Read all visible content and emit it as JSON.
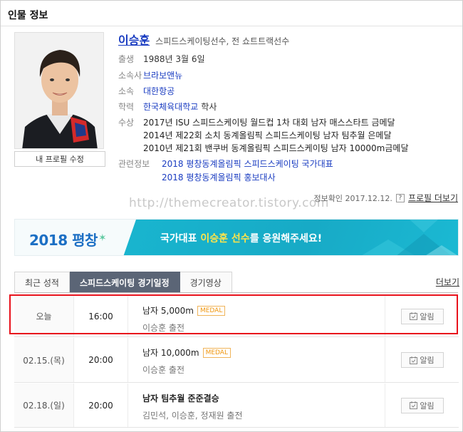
{
  "section_title": "인물 정보",
  "profile": {
    "edit_label": "내 프로필 수정",
    "name": "이승훈",
    "job": "스피드스케이팅선수, 전 쇼트트랙선수",
    "birth_label": "출생",
    "birth": "1988년 3월 6일",
    "agency_label": "소속사",
    "agency": "브라보앤뉴",
    "team_label": "소속",
    "team": "대한항공",
    "edu_label": "학력",
    "edu_school": "한국체육대학교",
    "edu_degree": "학사",
    "awards_label": "수상",
    "awards": [
      "2017년 ISU 스피드스케이팅 월드컵 1차 대회 남자 매스스타트 금메달",
      "2014년 제22회 소치 동계올림픽 스피드스케이팅 남자 팀추월 은메달",
      "2010년 제21회 밴쿠버 동계올림픽 스피드스케이팅 남자 10000m금메달"
    ],
    "related_label": "관련정보",
    "related": [
      "2018 평창동계올림픽 스피드스케이팅 국가대표",
      "2018 평창동계올림픽 홍보대사"
    ]
  },
  "watermark": "http://themecreator.tistory.com",
  "confirm": {
    "text": "정보확인 2017.12.12.",
    "help": "?",
    "more": "프로필 더보기"
  },
  "banner": {
    "left_text": "2018 평창",
    "pre": "국가대표 ",
    "highlight": "이승훈 선수",
    "post": "를 응원해주세요!"
  },
  "tabs": [
    {
      "label": "최근 성적",
      "active": false
    },
    {
      "label": "스피드스케이팅 경기일정",
      "active": true
    },
    {
      "label": "경기영상",
      "active": false
    }
  ],
  "tabs_more": "더보기",
  "schedule": [
    {
      "date": "오늘",
      "time": "16:00",
      "event": "남자 5,000m",
      "medal": "MEDAL",
      "players": "이승훈 출전",
      "alarm": "알림"
    },
    {
      "date": "02.15.(목)",
      "time": "20:00",
      "event": "남자 10,000m",
      "medal": "MEDAL",
      "players": "이승훈 출전",
      "alarm": "알림"
    },
    {
      "date": "02.18.(일)",
      "time": "20:00",
      "event": "남자 팀추월 준준결승",
      "medal": "",
      "players": "김민석, 이승훈, 정재원 출전",
      "alarm": "알림"
    }
  ],
  "colors": {
    "accent_link": "#1a3cc1",
    "highlight_border": "#e8121c",
    "medal": "#f0960e",
    "banner_teal": "#19b5cf"
  }
}
